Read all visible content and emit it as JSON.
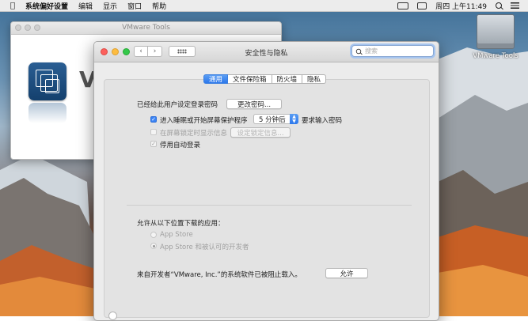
{
  "menubar": {
    "app_name": "系统偏好设置",
    "menus": [
      "编辑",
      "显示",
      "窗口",
      "帮助"
    ],
    "clock": "周四 上午11:49"
  },
  "desktop": {
    "volume_label": "VMware Tools"
  },
  "bg_window": {
    "title": "VMware Tools",
    "big_text": "V"
  },
  "window": {
    "title": "安全性与隐私",
    "search_placeholder": "搜索"
  },
  "tabs": [
    {
      "label": "通用",
      "active": true
    },
    {
      "label": "文件保险箱",
      "active": false
    },
    {
      "label": "防火墙",
      "active": false
    },
    {
      "label": "隐私",
      "active": false
    }
  ],
  "general": {
    "password_set_label": "已经给此用户设定登录密码",
    "change_password_button": "更改密码...",
    "require_password_label": "进入睡眠或开始屏幕保护程序",
    "require_password_delay": "5 分钟后",
    "require_password_suffix": "要求输入密码",
    "show_message_label": "在屏幕锁定时显示信息",
    "set_lock_message_button": "设定锁定信息...",
    "disable_autologin_label": "停用自动登录",
    "downloads_heading": "允许从以下位置下载的应用：",
    "option_app_store": "App Store",
    "option_app_store_dev": "App Store 和被认可的开发者",
    "blocked_message": "来自开发者“VMware, Inc.”的系统软件已被阻止载入。",
    "allow_button": "允许"
  },
  "colors": {
    "accent": "#2d78ec",
    "window_bg": "#ececec"
  }
}
